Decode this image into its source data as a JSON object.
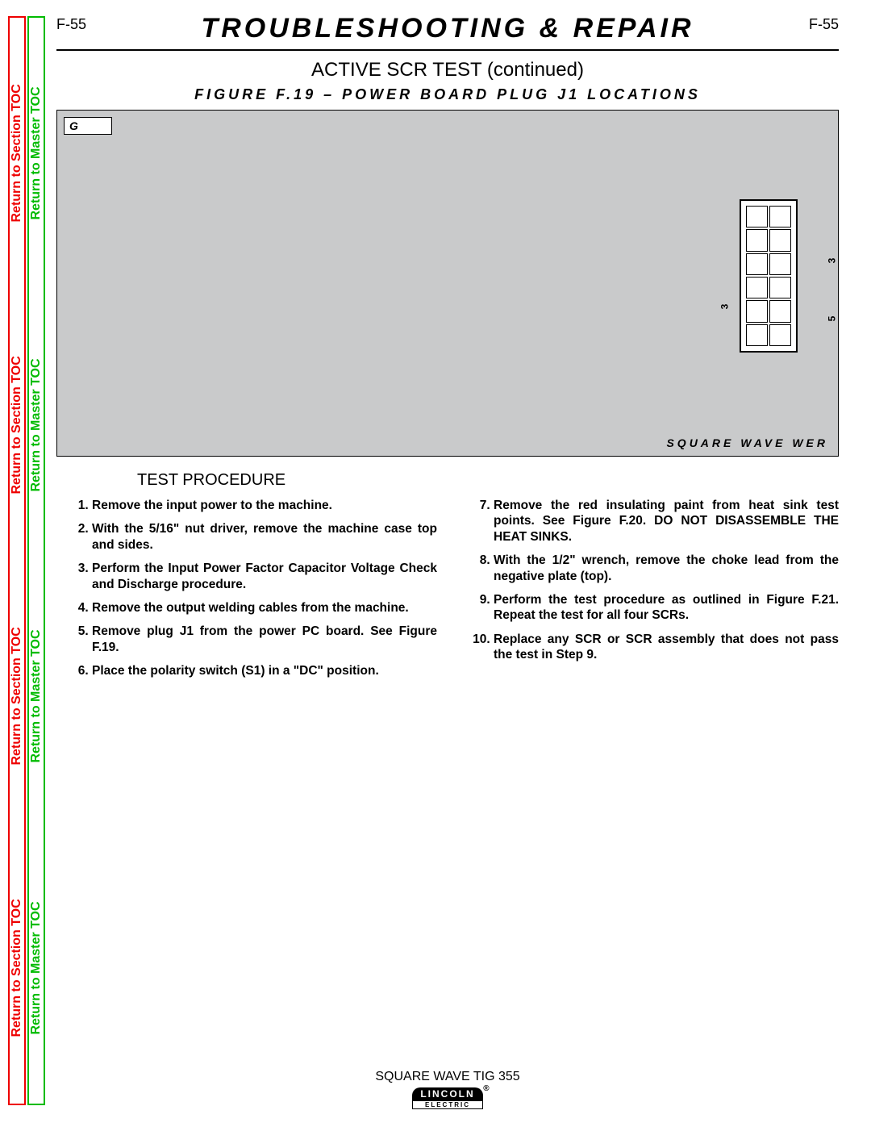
{
  "sidebar": {
    "section_label": "Return to Section TOC",
    "master_label": "Return to Master TOC"
  },
  "header": {
    "page_num": "F-55",
    "title": "TROUBLESHOOTING & REPAIR"
  },
  "subtitle": "ACTIVE SCR TEST  (continued)",
  "figure": {
    "title_line": "FIGURE F.19 – POWER BOARD PLUG J1 LOCATIONS",
    "badge": "G",
    "caption": "SQUARE WAVE     WER",
    "conn_left": "3",
    "conn_right_top": "3",
    "conn_right_bot": "5"
  },
  "procedure": {
    "heading": "TEST PROCEDURE",
    "left": [
      "Remove the input power to the machine.",
      "With the 5/16\" nut driver, remove the machine case top and sides.",
      "Perform the Input Power Factor Capacitor Voltage Check and Discharge procedure.",
      "Remove the output welding cables from the machine.",
      "Remove plug J1 from the power PC board. See Figure F.19.",
      "Place the polarity switch (S1) in a \"DC\" position."
    ],
    "right": [
      "Remove the red insulating paint from heat sink test points.  See Figure F.20.  DO NOT DISASSEMBLE THE HEAT SINKS.",
      "With the 1/2\" wrench, remove the choke lead from the negative plate (top).",
      "Perform the test procedure as outlined in Figure F.21.  Repeat the test for all four SCRs.",
      "Replace any SCR or SCR assembly that does not pass the test in Step 9."
    ]
  },
  "footer": {
    "model": "SQUARE WAVE TIG 355",
    "logo_top": "LINCOLN",
    "logo_bot": "ELECTRIC"
  }
}
